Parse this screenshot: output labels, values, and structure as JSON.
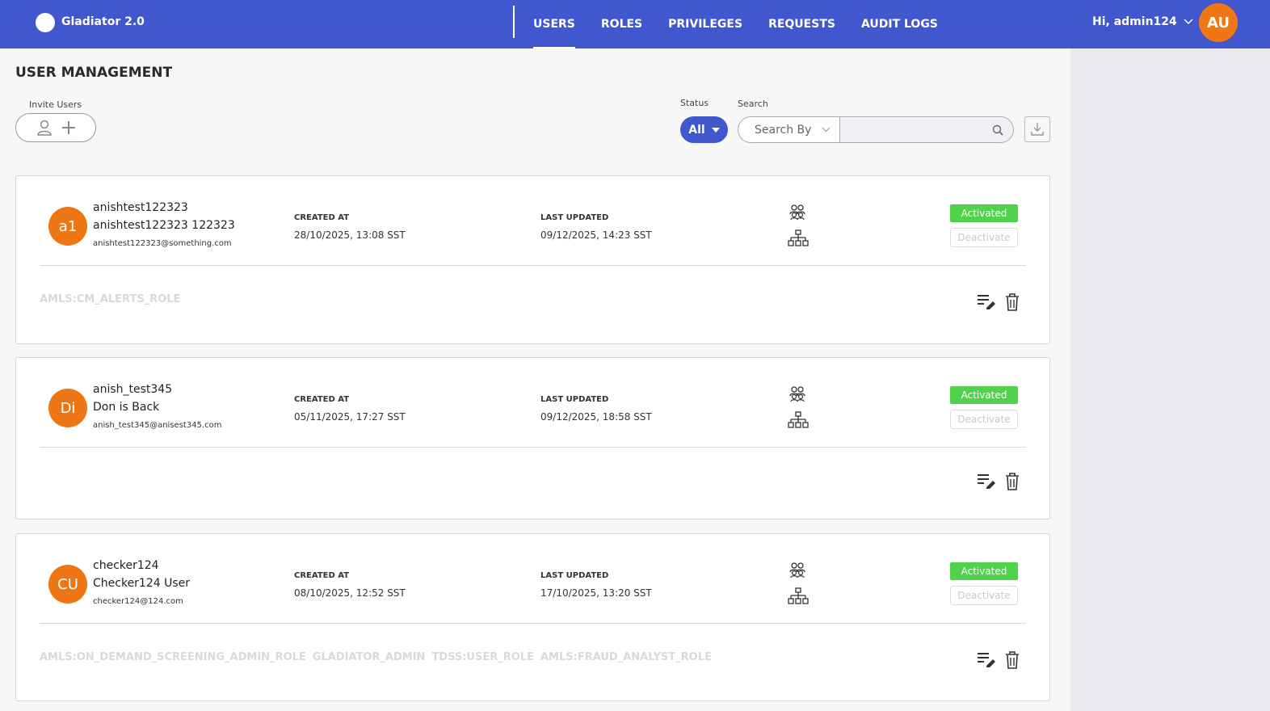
{
  "app": {
    "title": "Gladiator 2.0"
  },
  "nav": {
    "items": [
      {
        "label": "USERS",
        "active": true
      },
      {
        "label": "ROLES"
      },
      {
        "label": "PRIVILEGES"
      },
      {
        "label": "REQUESTS"
      },
      {
        "label": "AUDIT LOGS"
      }
    ],
    "greeting": "Hi, admin124",
    "avatar_initials": "AU"
  },
  "page": {
    "title": "USER MANAGEMENT",
    "invite_label": "Invite Users",
    "status_label": "Status",
    "status_value": "All",
    "search_label": "Search",
    "search_by_placeholder": "Search By",
    "search_value": ""
  },
  "users": [
    {
      "initials": "a1",
      "username": "anishtest122323",
      "full_name": "anishtest122323 122323",
      "email": "anishtest122323@something.com",
      "created_label": "CREATED AT",
      "created_at": "28/10/2025, 13:08 SST",
      "updated_label": "LAST UPDATED",
      "updated_at": "09/12/2025, 14:23 SST",
      "status": "Activated",
      "deactivate_label": "Deactivate",
      "roles": [
        "AMLS:CM_ALERTS_ROLE"
      ]
    },
    {
      "initials": "Di",
      "username": "anish_test345",
      "full_name": "Don is Back",
      "email": "anish_test345@anisest345.com",
      "created_label": "CREATED AT",
      "created_at": "05/11/2025, 17:27 SST",
      "updated_label": "LAST UPDATED",
      "updated_at": "09/12/2025, 18:58 SST",
      "status": "Activated",
      "deactivate_label": "Deactivate",
      "roles": []
    },
    {
      "initials": "CU",
      "username": "checker124",
      "full_name": "Checker124 User",
      "email": "checker124@124.com",
      "created_label": "CREATED AT",
      "created_at": "08/10/2025, 12:52 SST",
      "updated_label": "LAST UPDATED",
      "updated_at": "17/10/2025, 13:20 SST",
      "status": "Activated",
      "deactivate_label": "Deactivate",
      "roles": [
        "AMLS:ON_DEMAND_SCREENING_ADMIN_ROLE",
        "GLADIATOR_ADMIN",
        "TDSS:USER_ROLE",
        "AMLS:FRAUD_ANALYST_ROLE"
      ]
    }
  ],
  "colors": {
    "brand": "#4157cd",
    "avatar": "#ef7614",
    "activated": "#4fd34a"
  },
  "icons": {
    "logo": "logo-circle",
    "invite": "user-plus-icon",
    "search": "search-icon",
    "download": "download-icon",
    "group": "users-group-icon",
    "hierarchy": "hierarchy-icon",
    "edit": "edit-list-icon",
    "delete": "trash-icon"
  }
}
